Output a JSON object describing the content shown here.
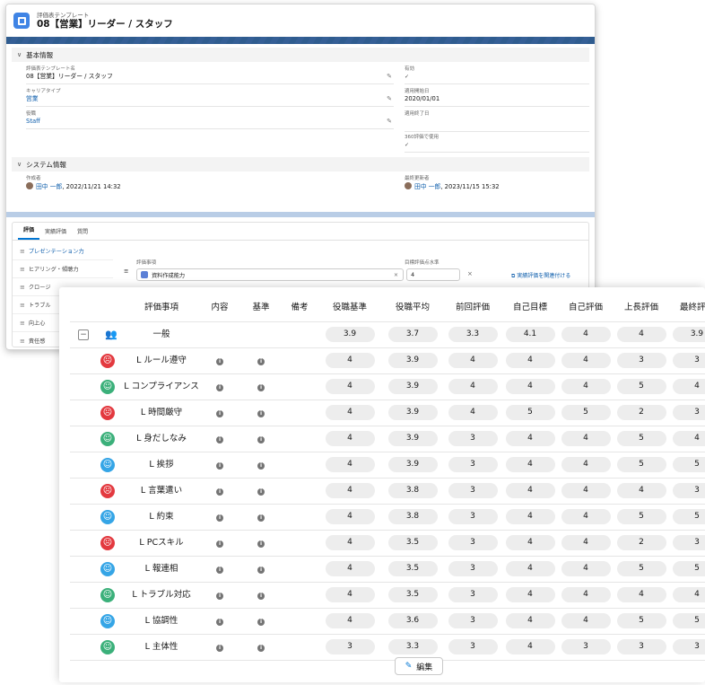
{
  "record": {
    "object_label": "評価表テンプレート",
    "title": "08【営業】リーダー / スタッフ"
  },
  "basic_section": {
    "heading": "基本情報",
    "fields": {
      "template_name_label": "評価表テンプレート名",
      "template_name_value": "08【営業】リーダー / スタッフ",
      "career_type_label": "キャリアタイプ",
      "career_type_value": "営業",
      "role_label": "役職",
      "role_value": "Staff",
      "active_label": "有効",
      "active_value": "✓",
      "start_date_label": "適用開始日",
      "start_date_value": "2020/01/01",
      "end_date_label": "適用終了日",
      "end_date_value": "",
      "use360_label": "360評価で使用",
      "use360_value": "✓"
    }
  },
  "system_section": {
    "heading": "システム情報",
    "created_by_label": "作成者",
    "created_by_name": "田中 一郎",
    "created_by_date": ", 2022/11/21 14:32",
    "modified_by_label": "最終更新者",
    "modified_by_name": "田中 一郎",
    "modified_by_date": ", 2023/11/15 15:32"
  },
  "tabs": [
    "評価",
    "実績評価",
    "質問"
  ],
  "side_items": [
    "プレゼンテーション力",
    "ヒアリング・傾聴力",
    "クロージ",
    "トラブル",
    "向上心",
    "責任感"
  ],
  "eval_editor": {
    "item_label": "評価事項",
    "item_value": "資料作成能力",
    "target_label": "目標評価点水準",
    "target_value": "4",
    "link_label": "実績評価を関連付ける"
  },
  "grid": {
    "headers": [
      "評価事項",
      "内容",
      "基準",
      "備考",
      "役職基準",
      "役職平均",
      "前回評価",
      "自己目標",
      "自己評価",
      "上長評価",
      "最終評価"
    ],
    "group": {
      "name": "一般",
      "values": [
        "3.9",
        "3.7",
        "3.3",
        "4.1",
        "4",
        "4",
        "3.9"
      ]
    },
    "rows": [
      {
        "face": "red",
        "name": "L ルール遵守",
        "values": [
          "4",
          "3.9",
          "4",
          "4",
          "4",
          "3",
          "3"
        ]
      },
      {
        "face": "green",
        "name": "L コンプライアンス",
        "values": [
          "4",
          "3.9",
          "4",
          "4",
          "4",
          "5",
          "4"
        ]
      },
      {
        "face": "red",
        "name": "L 時間厳守",
        "values": [
          "4",
          "3.9",
          "4",
          "5",
          "5",
          "2",
          "3"
        ]
      },
      {
        "face": "green",
        "name": "L 身だしなみ",
        "values": [
          "4",
          "3.9",
          "3",
          "4",
          "4",
          "5",
          "4"
        ]
      },
      {
        "face": "blue",
        "name": "L 挨拶",
        "values": [
          "4",
          "3.9",
          "3",
          "4",
          "4",
          "5",
          "5"
        ]
      },
      {
        "face": "red",
        "name": "L 言葉遣い",
        "values": [
          "4",
          "3.8",
          "3",
          "4",
          "4",
          "4",
          "3"
        ]
      },
      {
        "face": "blue",
        "name": "L 約束",
        "values": [
          "4",
          "3.8",
          "3",
          "4",
          "4",
          "5",
          "5"
        ]
      },
      {
        "face": "red",
        "name": "L PCスキル",
        "values": [
          "4",
          "3.5",
          "3",
          "4",
          "4",
          "2",
          "3"
        ]
      },
      {
        "face": "blue",
        "name": "L 報連相",
        "values": [
          "4",
          "3.5",
          "3",
          "4",
          "4",
          "5",
          "5"
        ]
      },
      {
        "face": "green",
        "name": "L トラブル対応",
        "values": [
          "4",
          "3.5",
          "3",
          "4",
          "4",
          "4",
          "4"
        ]
      },
      {
        "face": "blue",
        "name": "L 協調性",
        "values": [
          "4",
          "3.6",
          "3",
          "4",
          "4",
          "5",
          "5"
        ]
      },
      {
        "face": "green",
        "name": "L 主体性",
        "values": [
          "3",
          "3.3",
          "3",
          "4",
          "3",
          "3",
          "3"
        ]
      }
    ],
    "info_glyph": "i"
  },
  "edit_button": {
    "label": "編集"
  },
  "colors": {
    "face_red": "#e3393f",
    "face_green": "#3bb07a",
    "face_blue": "#35a5e6",
    "brand": "#0176d3"
  },
  "icons": {
    "record_icon": "template-icon",
    "pencil": "pencil-icon",
    "group": "group-icon"
  }
}
